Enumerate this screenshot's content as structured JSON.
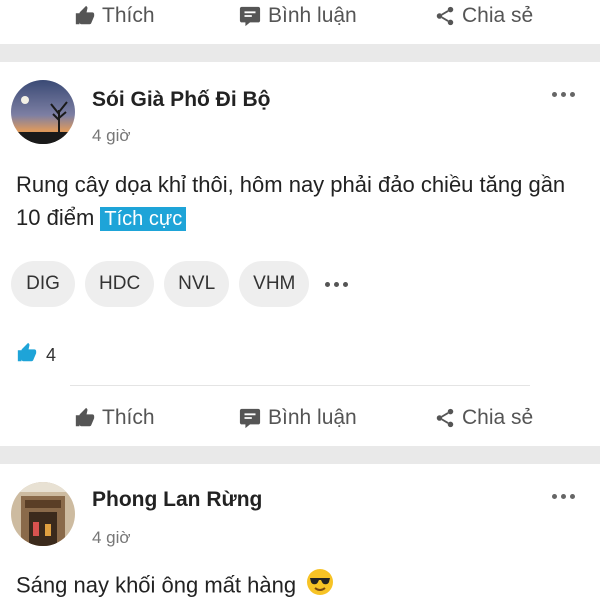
{
  "actions": {
    "like_label": "Thích",
    "comment_label": "Bình luận",
    "share_label": "Chia sẻ"
  },
  "post1": {
    "author": "Sói Già Phố Đi Bộ",
    "time": "4 giờ",
    "text": "Rung cây dọa khỉ thôi, hôm nay phải đảo chiều tăng gần 10 điểm",
    "sentiment": "Tích cực",
    "tickers": [
      "DIG",
      "HDC",
      "NVL",
      "VHM"
    ],
    "like_count": "4",
    "like_icon_color": "#1ea4d8"
  },
  "post2": {
    "author": "Phong Lan Rừng",
    "time": "4 giờ",
    "text": "Sáng nay khối ông mất hàng",
    "emoji": "sunglasses-emoji"
  },
  "colors": {
    "accent": "#1ea4d8",
    "divider": "#e9e9e9",
    "chip_bg": "#eeeeee"
  }
}
